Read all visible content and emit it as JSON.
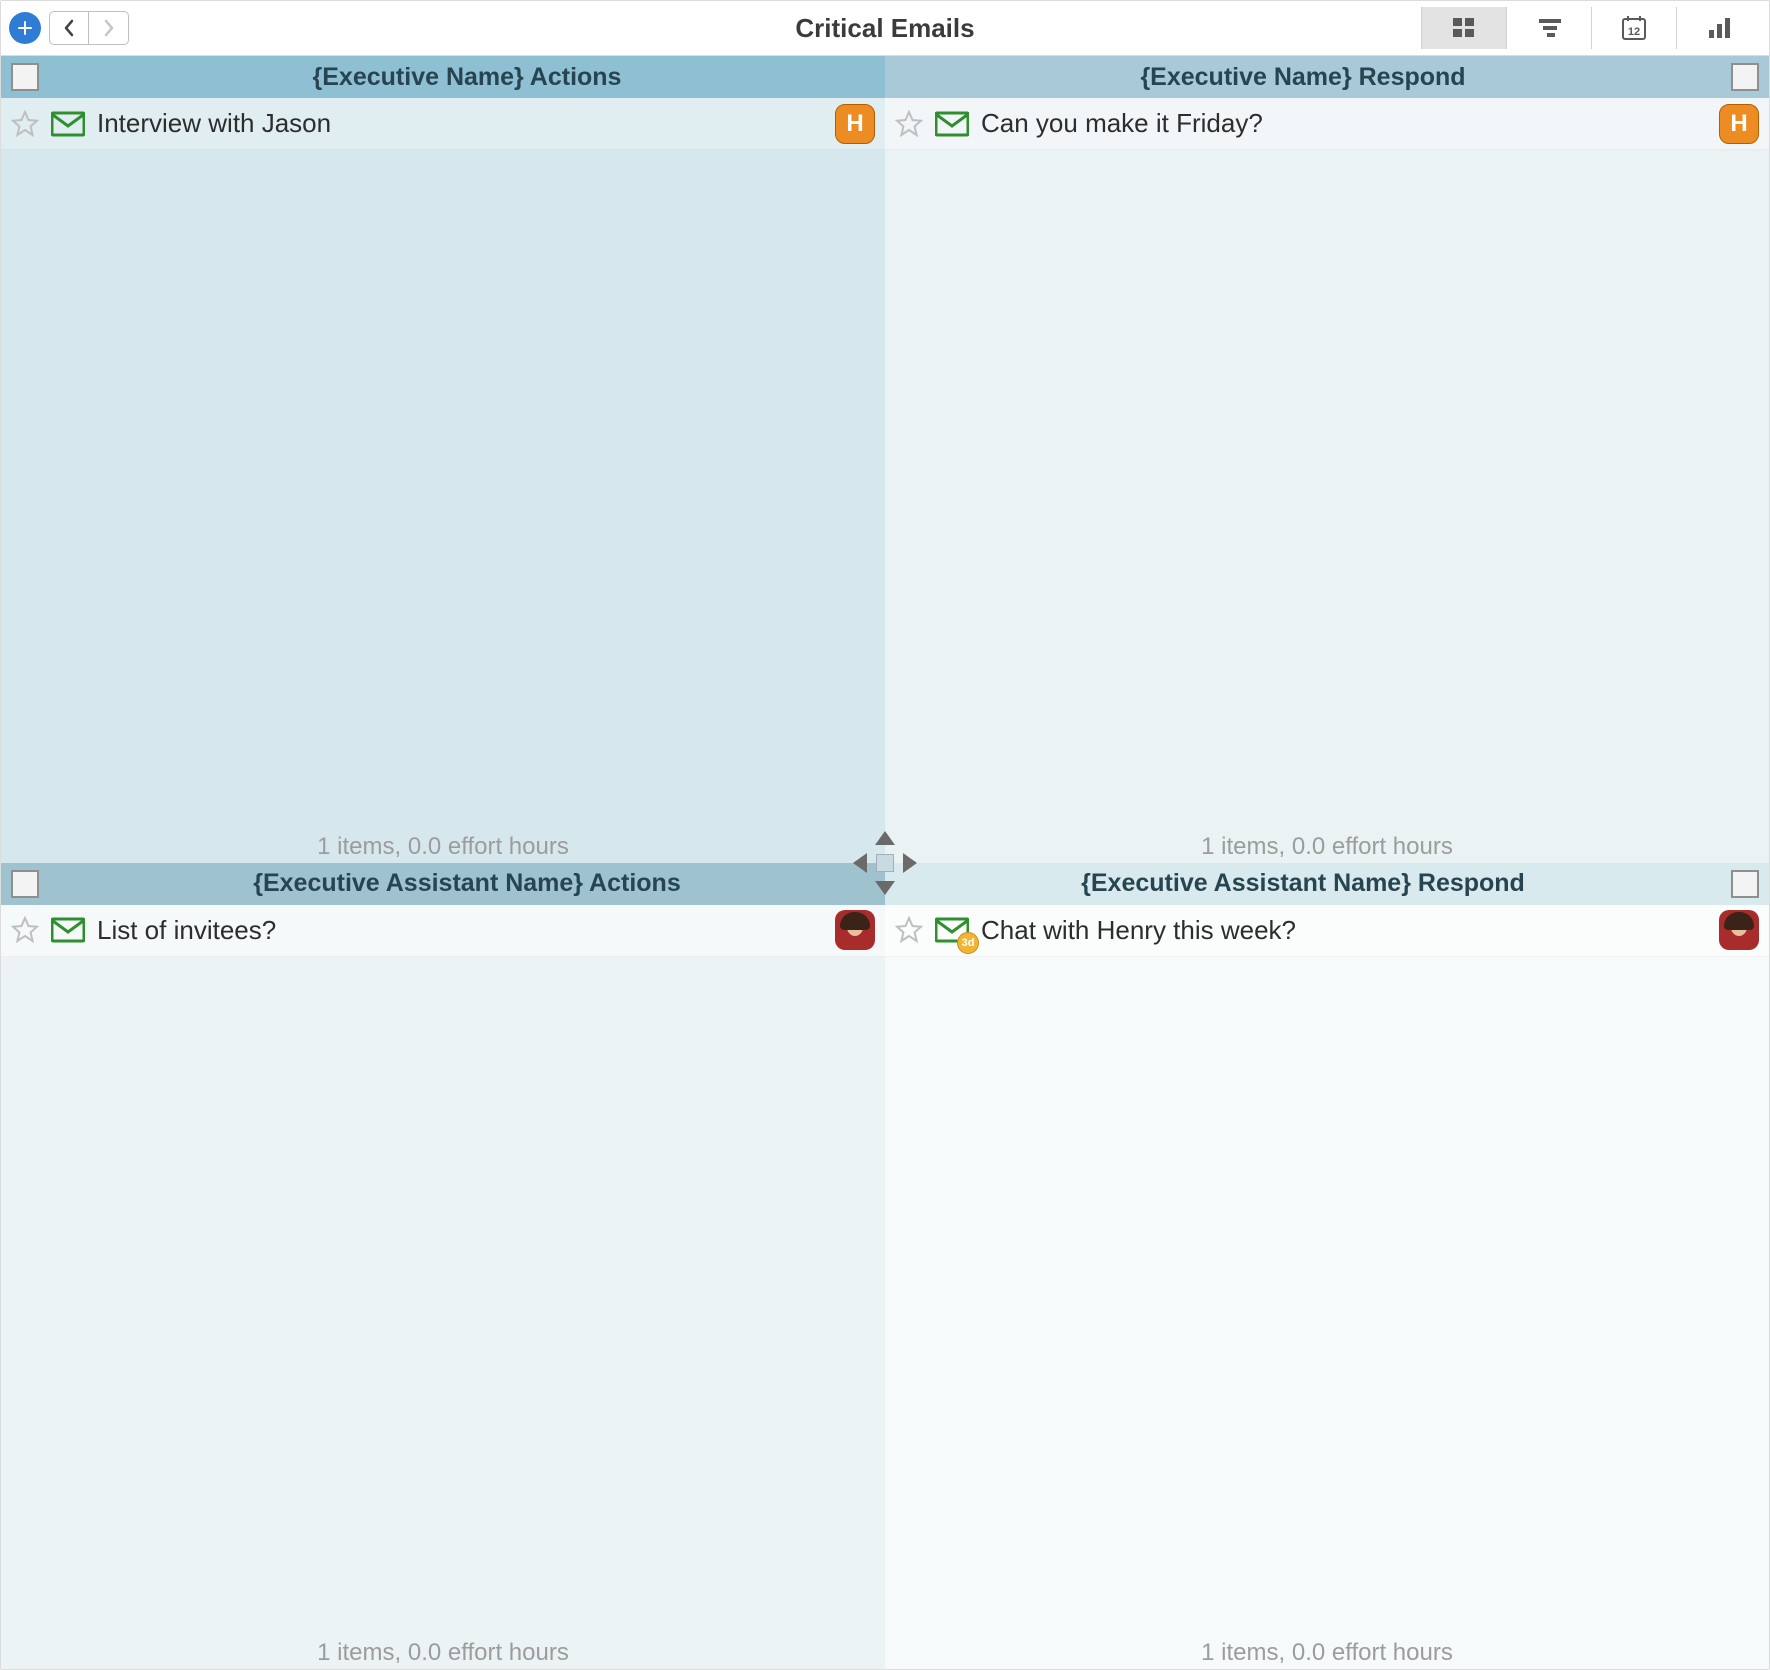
{
  "colors": {
    "header_strong": "#8fbfd3",
    "header_med": "#a7c9d8",
    "pane_tl": "#d6e8ee",
    "pane_tr": "#ebf2f4",
    "pane_bl": "#ecf3f4",
    "pane_br": "#f6fafb",
    "avatar_orange": "#ed8c22",
    "badge_yellow": "#f2b531"
  },
  "toolbar": {
    "title": "Critical Emails",
    "add_label": "+",
    "calendar_date": "12"
  },
  "quadrants": [
    {
      "id": "tl",
      "title": "{Executive Name} Actions",
      "check_side": "left",
      "summary": "1 items, 0.0 effort hours",
      "tasks": [
        {
          "title": "Interview with Jason",
          "starred": false,
          "icon": "mail",
          "assignee": {
            "type": "letter",
            "letter": "H",
            "color": "orange"
          },
          "badge": null
        }
      ]
    },
    {
      "id": "tr",
      "title": "{Executive Name} Respond",
      "check_side": "right",
      "summary": "1 items, 0.0 effort hours",
      "tasks": [
        {
          "title": "Can you make it Friday?",
          "starred": false,
          "icon": "mail",
          "assignee": {
            "type": "letter",
            "letter": "H",
            "color": "orange"
          },
          "badge": null
        }
      ]
    },
    {
      "id": "bl",
      "title": "{Executive Assistant Name} Actions",
      "check_side": "left",
      "summary": "1 items, 0.0 effort hours",
      "tasks": [
        {
          "title": "List of invitees?",
          "starred": false,
          "icon": "mail",
          "assignee": {
            "type": "photo"
          },
          "badge": null
        }
      ]
    },
    {
      "id": "br",
      "title": "{Executive Assistant Name} Respond",
      "check_side": "right",
      "summary": "1 items, 0.0 effort hours",
      "tasks": [
        {
          "title": "Chat with Henry this week?",
          "starred": false,
          "icon": "mail",
          "assignee": {
            "type": "photo"
          },
          "badge": "3d"
        }
      ]
    }
  ]
}
